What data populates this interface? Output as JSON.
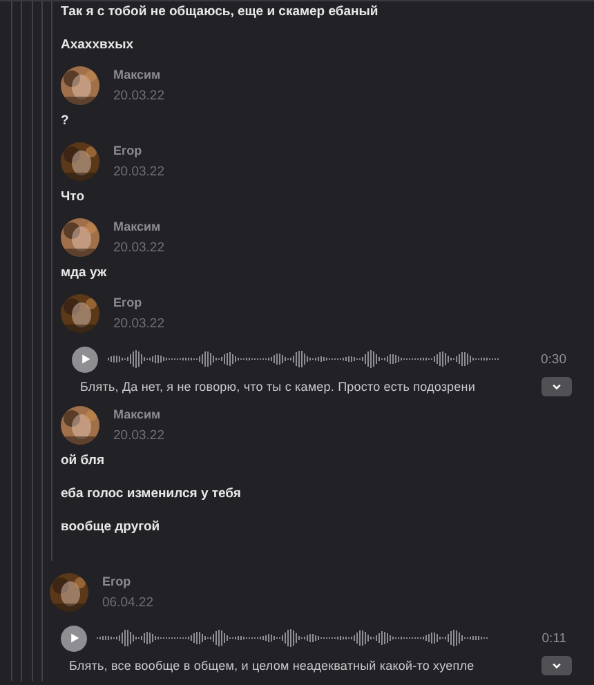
{
  "threads": [
    {
      "items": [
        {
          "kind": "text",
          "text": "Так я с тобой не общаюсь, еще и скамер ебаный"
        },
        {
          "kind": "text",
          "text": "Ахаххвхых"
        },
        {
          "kind": "author",
          "name": "Максим",
          "date": "20.03.22",
          "color": "#a0704a"
        },
        {
          "kind": "text",
          "text": "?"
        },
        {
          "kind": "author",
          "name": "Егор",
          "date": "20.03.22",
          "color": "#5a3818"
        },
        {
          "kind": "text",
          "text": "Что"
        },
        {
          "kind": "author",
          "name": "Максим",
          "date": "20.03.22",
          "color": "#a0704a"
        },
        {
          "kind": "text",
          "text": "мда уж"
        },
        {
          "kind": "author",
          "name": "Егор",
          "date": "20.03.22",
          "color": "#5a3818"
        },
        {
          "kind": "voice",
          "duration": "0:30",
          "transcript": "Блять, Да нет, я не говорю, что ты с камер. Просто есть подозрени"
        },
        {
          "kind": "author",
          "name": "Максим",
          "date": "20.03.22",
          "color": "#a0704a"
        },
        {
          "kind": "text",
          "text": "ой бля"
        },
        {
          "kind": "text",
          "text": "еба голос изменился у тебя"
        },
        {
          "kind": "text",
          "text": "вообще другой"
        }
      ]
    },
    {
      "items": [
        {
          "kind": "author",
          "name": "Егор",
          "date": "06.04.22",
          "color": "#5a3818"
        },
        {
          "kind": "voice",
          "duration": "0:11",
          "transcript": "Блять, все вообще в общем, и целом неадекватный какой-то хуепле"
        }
      ]
    }
  ]
}
